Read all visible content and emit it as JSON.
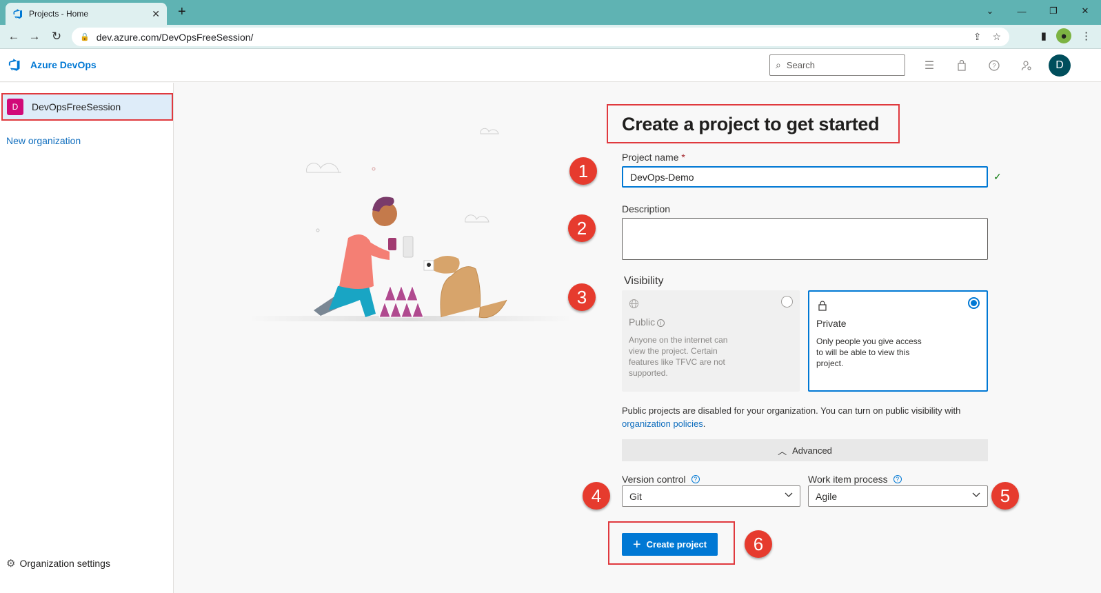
{
  "browser": {
    "tab_title": "Projects - Home",
    "url": "dev.azure.com/DevOpsFreeSession/"
  },
  "header": {
    "brand": "Azure DevOps",
    "search_placeholder": "Search",
    "avatar_initial": "D"
  },
  "sidebar": {
    "org_badge": "D",
    "org_name": "DevOpsFreeSession",
    "new_org": "New organization",
    "settings": "Organization settings"
  },
  "form": {
    "title": "Create a project to get started",
    "project_name_label": "Project name",
    "required_mark": "*",
    "project_name_value": "DevOps-Demo",
    "description_label": "Description",
    "visibility_label": "Visibility",
    "public": {
      "title": "Public",
      "desc": "Anyone on the internet can view the project. Certain features like TFVC are not supported.",
      "selected": false
    },
    "private": {
      "title": "Private",
      "desc": "Only people you give access to will be able to view this project.",
      "selected": true
    },
    "notice": "Public projects are disabled for your organization. You can turn on public visibility with",
    "notice_link": "organization policies",
    "notice_end": ".",
    "advanced": "Advanced",
    "version_control_label": "Version control",
    "version_control_value": "Git",
    "work_item_label": "Work item process",
    "work_item_value": "Agile",
    "create_button": "Create project"
  },
  "steps": [
    "1",
    "2",
    "3",
    "4",
    "5",
    "6"
  ],
  "colors": {
    "accent": "#0078d4",
    "highlight_red": "#e0393e",
    "step_red": "#e63b2e",
    "browser_teal": "#5fb3b3",
    "org_badge": "#d10a78"
  }
}
